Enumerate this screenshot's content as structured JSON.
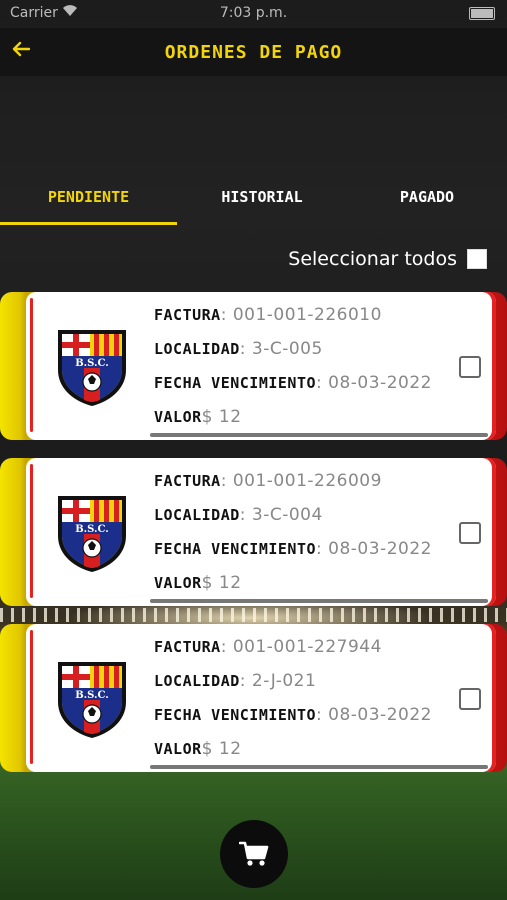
{
  "status_bar": {
    "carrier": "Carrier",
    "time": "7:03 p.m."
  },
  "header": {
    "title": "ORDENES DE PAGO",
    "back_icon": "arrow-left-icon"
  },
  "tabs": [
    {
      "label": "PENDIENTE",
      "active": true
    },
    {
      "label": "HISTORIAL",
      "active": false
    },
    {
      "label": "PAGADO",
      "active": false
    }
  ],
  "select_all": {
    "label": "Seleccionar todos",
    "checked": false
  },
  "labels": {
    "factura": "FACTURA",
    "localidad": "LOCALIDAD",
    "fecha": "FECHA VENCIMIENTO",
    "valor": "VALOR"
  },
  "orders": [
    {
      "factura": ": 001-001-226010",
      "localidad": ": 3-C-005",
      "fecha": ": 08-03-2022",
      "valor": "$ 12",
      "checked": false
    },
    {
      "factura": ": 001-001-226009",
      "localidad": ": 3-C-004",
      "fecha": ": 08-03-2022",
      "valor": "$ 12",
      "checked": false
    },
    {
      "factura": ": 001-001-227944",
      "localidad": ": 2-J-021",
      "fecha": ": 08-03-2022",
      "valor": "$ 12",
      "checked": false
    }
  ],
  "crest_text": "B.S.C.",
  "colors": {
    "accent": "#f2d40b",
    "card_red": "#e52121",
    "card_yellow": "#f4e400"
  },
  "cart": {
    "icon": "shopping-cart-icon"
  }
}
